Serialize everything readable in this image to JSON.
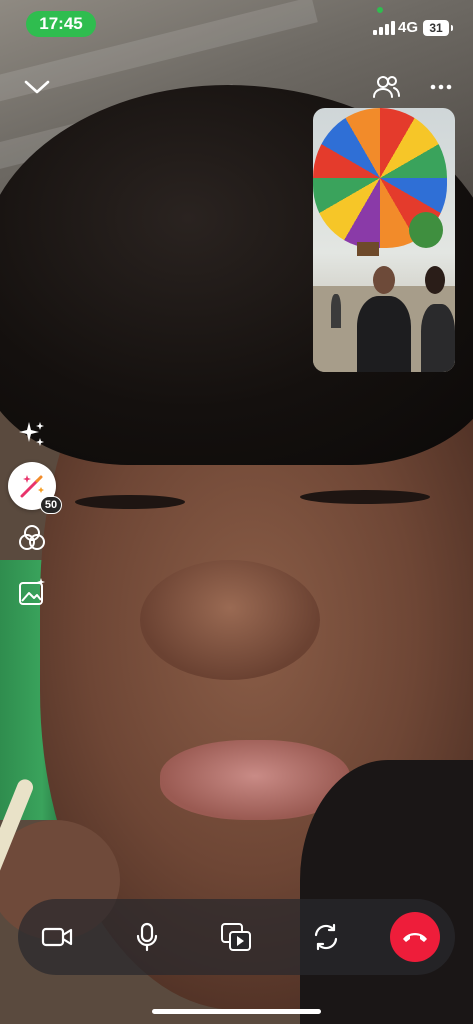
{
  "status_bar": {
    "time": "17:45",
    "network": "4G",
    "battery": "31"
  },
  "top_controls": {
    "collapse_icon": "chevron-down-icon",
    "participants_icon": "people-icon",
    "more_icon": "ellipsis-icon"
  },
  "side_tools": {
    "sparkles_icon": "sparkles-icon",
    "effects_icon": "magic-wand-icon",
    "effects_count": "50",
    "filters_icon": "color-filter-icon",
    "background_icon": "image-sparkle-icon"
  },
  "call_controls": {
    "camera_icon": "video-camera-icon",
    "mic_icon": "microphone-icon",
    "media_share_icon": "media-share-icon",
    "flip_camera_icon": "flip-camera-icon",
    "end_call_icon": "phone-hangup-icon",
    "end_call_color": "#ee1d3a"
  },
  "colors": {
    "status_pill": "#2fbd4f",
    "bar_background": "#28282c"
  }
}
